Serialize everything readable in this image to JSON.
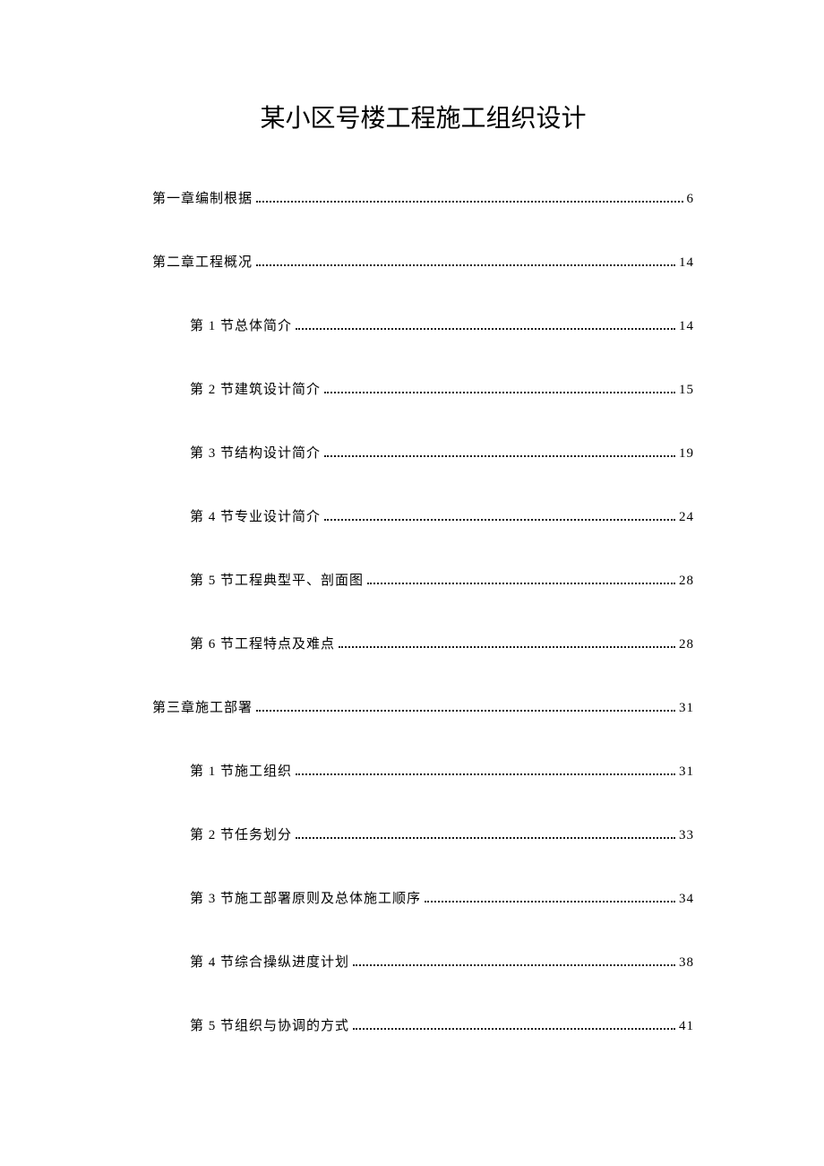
{
  "title": "某小区号楼工程施工组织设计",
  "toc": [
    {
      "level": 1,
      "label": "第一章编制根据",
      "page": "6"
    },
    {
      "level": 1,
      "label": "第二章工程概况",
      "page": "14"
    },
    {
      "level": 2,
      "label": "第 1 节总体简介",
      "page": "14"
    },
    {
      "level": 2,
      "label": "第 2 节建筑设计简介",
      "page": "15"
    },
    {
      "level": 2,
      "label": "第 3 节结构设计简介",
      "page": "19"
    },
    {
      "level": 2,
      "label": "第 4 节专业设计简介",
      "page": "24"
    },
    {
      "level": 2,
      "label": "第 5 节工程典型平、剖面图",
      "page": "28"
    },
    {
      "level": 2,
      "label": "第 6 节工程特点及难点",
      "page": "28"
    },
    {
      "level": 1,
      "label": "第三章施工部署",
      "page": "31"
    },
    {
      "level": 2,
      "label": "第 1 节施工组织",
      "page": "31"
    },
    {
      "level": 2,
      "label": "第 2 节任务划分",
      "page": "33"
    },
    {
      "level": 2,
      "label": "第 3 节施工部署原则及总体施工顺序",
      "page": "34"
    },
    {
      "level": 2,
      "label": "第 4 节综合操纵进度计划",
      "page": "38"
    },
    {
      "level": 2,
      "label": "第 5 节组织与协调的方式",
      "page": "41"
    }
  ]
}
